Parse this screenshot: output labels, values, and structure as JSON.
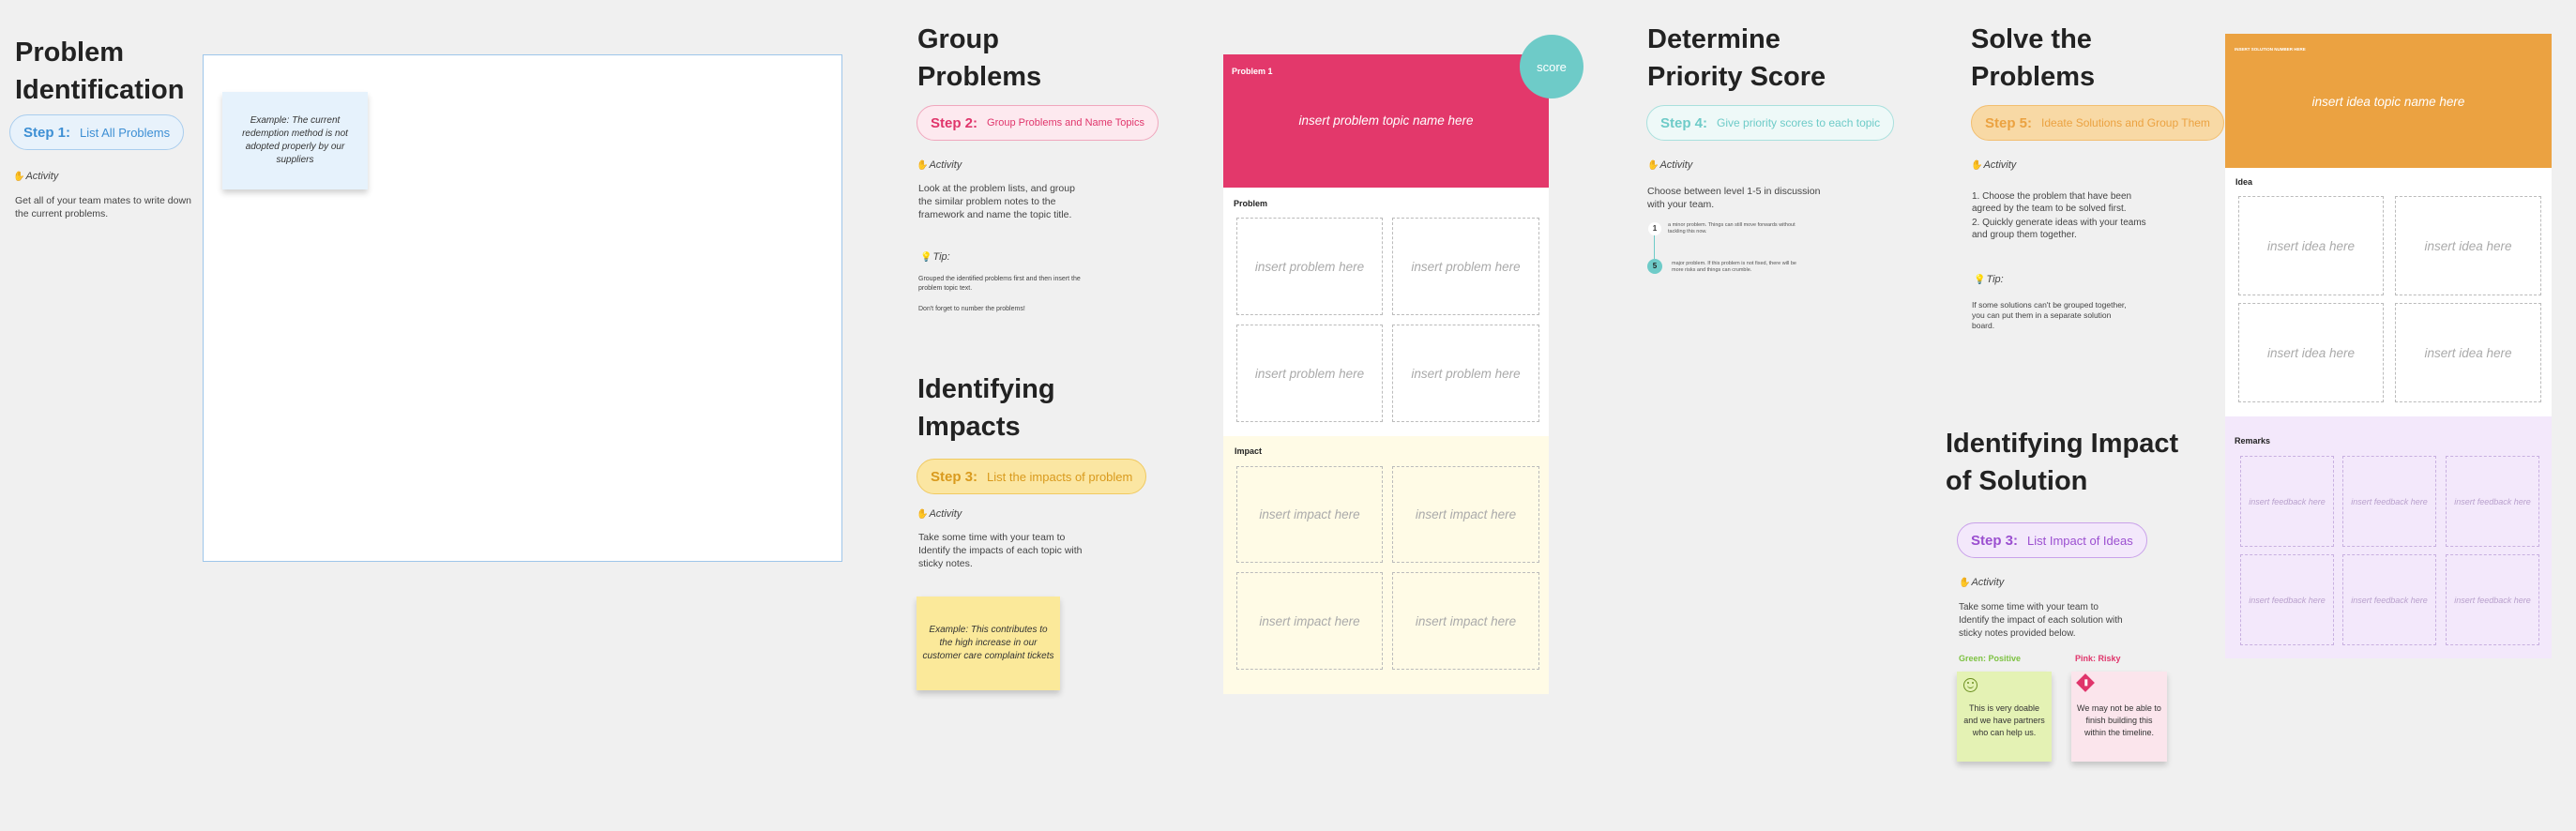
{
  "step1": {
    "title": "Problem Identification",
    "step": "Step 1:",
    "pill": "List All Problems",
    "activity": "Activity",
    "desc": "Get all of your team mates to write down the current problems.",
    "sticky": "Example: The current redemption method is not adopted properly by our suppliers"
  },
  "step2": {
    "title": "Group Problems",
    "step": "Step 2:",
    "pill": "Group Problems and Name Topics",
    "activity": "Activity",
    "desc": "Look at the problem lists, and group the similar problem notes to the framework and name the topic title.",
    "tip_label": "Tip:",
    "tip1": "Grouped the identified problems first and then insert the problem topic text.",
    "tip2": "Don't forget to number the problems!"
  },
  "step3": {
    "title": "Identifying Impacts",
    "step": "Step 3:",
    "pill": "List the impacts of problem",
    "activity": "Activity",
    "desc": "Take some time with your team to Identify the impacts of each topic with sticky notes.",
    "sticky": "Example: This contributes to the high increase in our customer care complaint tickets"
  },
  "board1": {
    "label": "Problem 1",
    "topic": "insert problem topic name here",
    "score": "score",
    "problem_label": "Problem",
    "problem_cells": [
      "insert problem here",
      "insert problem here",
      "insert problem here",
      "insert problem here"
    ],
    "impact_label": "Impact",
    "impact_cells": [
      "insert impact here",
      "insert impact here",
      "insert impact here",
      "insert impact here"
    ]
  },
  "step4": {
    "title": "Determine Priority Score",
    "step": "Step 4:",
    "pill": "Give priority scores to each topic",
    "activity": "Activity",
    "desc": "Choose between level 1-5 in discussion with your team.",
    "level1_num": "1",
    "level1_text": "a minor problem. Things can still move forwards without tackling this now.",
    "level5_num": "5",
    "level5_text": "major problem. If this problem is not fixed, there will be more risks and things can crumble."
  },
  "step5": {
    "title": "Solve the Problems",
    "step": "Step 5:",
    "pill": "Ideate Solutions and Group Them",
    "activity": "Activity",
    "desc1": "1. Choose the problem that have been agreed by the team to be solved first.",
    "desc2": "2. Quickly generate ideas with your teams and group them together.",
    "tip_label": "Tip:",
    "tip": "If some solutions can't be grouped together, you can put them in a separate solution board."
  },
  "step6": {
    "title": "Identifying Impact of Solution",
    "step": "Step 3:",
    "pill": "List Impact of Ideas",
    "activity": "Activity",
    "desc": "Take some time with your team to Identify the impact of each solution with sticky notes provided below.",
    "green_label": "Green: Positive",
    "pink_label": "Pink: Risky",
    "green_sticky": "This is very doable and we have partners who can help us.",
    "pink_sticky": "We may not be able to finish building this within the timeline."
  },
  "board2": {
    "header_small": "INSERT SOLUTION NUMBER HERE",
    "topic": "insert idea topic name here",
    "idea_label": "Idea",
    "idea_cells": [
      "insert idea here",
      "insert idea here",
      "insert idea here",
      "insert idea here"
    ],
    "remarks_label": "Remarks",
    "feedback_cells": [
      "insert feedback here",
      "insert feedback here",
      "insert feedback here",
      "insert feedback here",
      "insert feedback here",
      "insert feedback here"
    ]
  },
  "colors": {
    "blue": "#3d8fd4",
    "pink": "#e0356b",
    "yellow": "#f2d26b",
    "teal": "#6ecbc8",
    "orange": "#eba241",
    "purple": "#9b4fd0"
  }
}
